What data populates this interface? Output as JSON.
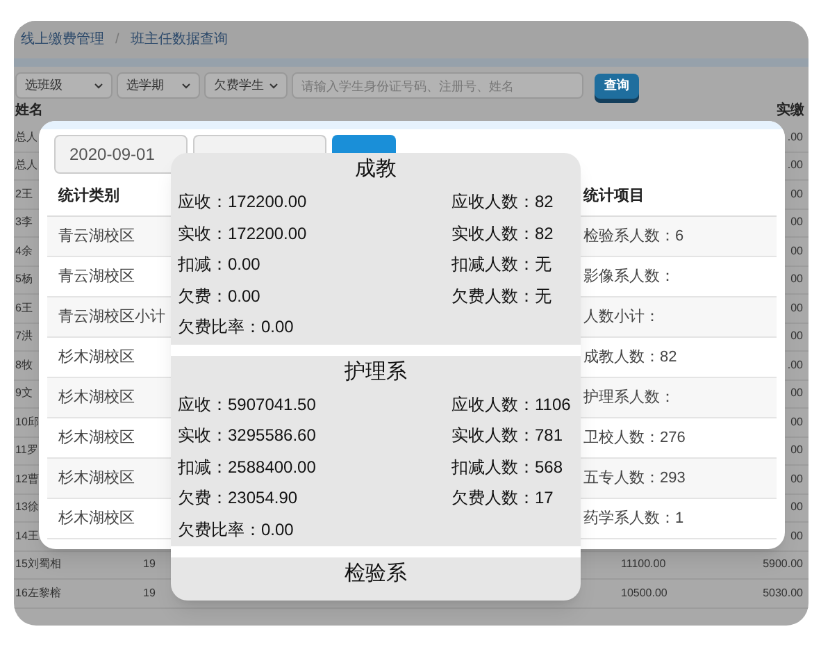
{
  "breadcrumb": {
    "items": [
      "线上缴费管理",
      "班主任数据查询"
    ],
    "separator": "/"
  },
  "filters": {
    "selects": [
      "选班级",
      "选学期",
      "欠费学生"
    ],
    "search": {
      "placeholder": "请输入学生身份证号码、注册号、姓名"
    },
    "button": "查询"
  },
  "table": {
    "columns": [
      "姓名",
      "实缴"
    ],
    "rows": [
      {
        "name": "总人",
        "paid": ".00"
      },
      {
        "name": "总人",
        "paid": ".00"
      },
      {
        "name": "2王",
        "paid": "00"
      },
      {
        "name": "3李",
        "paid": "00"
      },
      {
        "name": "4余",
        "paid": "00"
      },
      {
        "name": "5杨",
        "paid": "00"
      },
      {
        "name": "6王",
        "paid": "00"
      },
      {
        "name": "7洪",
        "paid": "00"
      },
      {
        "name": "8牧",
        "paid": ".00"
      },
      {
        "name": "9文",
        "paid": "00"
      },
      {
        "name": "10邱",
        "paid": "00"
      },
      {
        "name": "11罗",
        "paid": "00"
      },
      {
        "name": "12曹",
        "paid": "00"
      },
      {
        "name": "13徐",
        "paid": "00"
      },
      {
        "name": "14王",
        "paid": "00"
      },
      {
        "name": "15刘蜀相",
        "class": "19",
        "due": "11100.00",
        "paid": "5900.00"
      },
      {
        "name": "16左黎榕",
        "class": "19",
        "due": "10500.00",
        "paid": "5030.00"
      }
    ]
  },
  "dialog": {
    "start_date": "2020-09-01",
    "columns": [
      "统计类别",
      "统计项目"
    ],
    "rows": [
      [
        "青云湖校区",
        "检验系人数：6"
      ],
      [
        "青云湖校区",
        "影像系人数："
      ],
      [
        "青云湖校区小计",
        "人数小计："
      ],
      [
        "杉木湖校区",
        "成教人数：82"
      ],
      [
        "杉木湖校区",
        "护理系人数："
      ],
      [
        "杉木湖校区",
        "卫校人数：276"
      ],
      [
        "杉木湖校区",
        "五专人数：293"
      ],
      [
        "杉木湖校区",
        "药学系人数：1"
      ]
    ]
  },
  "popup": {
    "sections": [
      {
        "title": "成教",
        "rows": [
          [
            "应收：172200.00",
            "应收人数：82"
          ],
          [
            "实收：172200.00",
            "实收人数：82"
          ],
          [
            "扣减：0.00",
            "扣减人数：无"
          ],
          [
            "欠费：0.00",
            "欠费人数：无"
          ],
          [
            "欠费比率：0.00",
            ""
          ]
        ]
      },
      {
        "title": "护理系",
        "rows": [
          [
            "应收：5907041.50",
            "应收人数：1106"
          ],
          [
            "实收：3295586.60",
            "实收人数：781"
          ],
          [
            "扣减：2588400.00",
            "扣减人数：568"
          ],
          [
            "欠费：23054.90",
            "欠费人数：17"
          ],
          [
            "欠费比率：0.00",
            ""
          ]
        ]
      },
      {
        "title": "检验系"
      }
    ]
  }
}
